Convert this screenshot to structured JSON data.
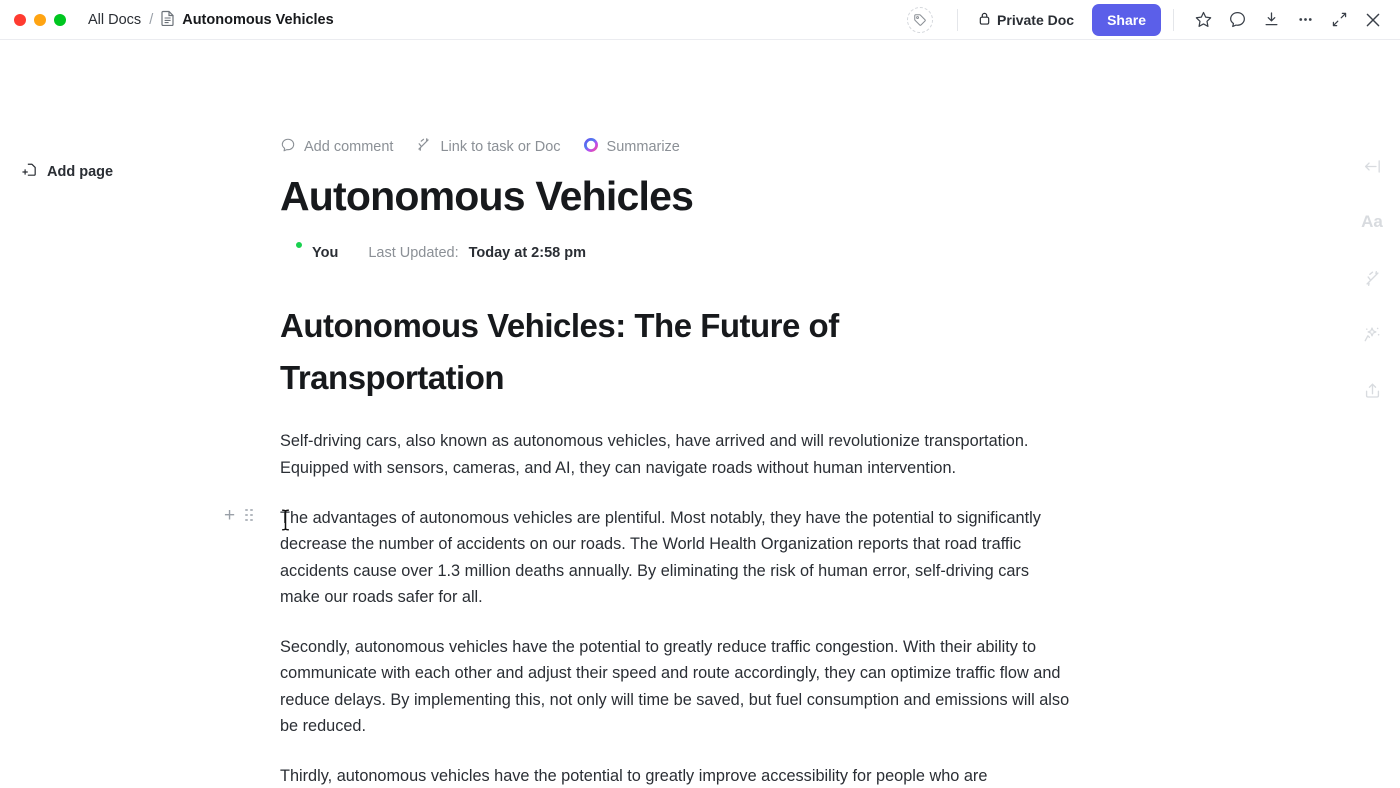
{
  "window": {
    "traffic_lights": [
      "close",
      "minimize",
      "maximize"
    ],
    "colors": {
      "red": "#ff3b30",
      "yellow": "#ffa412",
      "green": "#00c620",
      "accent": "#5b5fe9"
    }
  },
  "breadcrumb": {
    "root": "All Docs",
    "separator": "/",
    "current": "Autonomous Vehicles"
  },
  "titlebar": {
    "tag_icon": "tag-icon",
    "privacy_label": "Private Doc",
    "privacy_icon": "lock-icon",
    "share_label": "Share",
    "icons": [
      {
        "name": "star-icon",
        "title": "Favorite"
      },
      {
        "name": "comment-icon",
        "title": "Comments"
      },
      {
        "name": "download-icon",
        "title": "Download"
      },
      {
        "name": "more-options-icon",
        "title": "More"
      },
      {
        "name": "collapse-icon",
        "title": "Collapse"
      },
      {
        "name": "close-icon",
        "title": "Close"
      }
    ]
  },
  "sidebar": {
    "add_page_label": "Add page",
    "add_page_icon": "add-page-icon"
  },
  "doc_toolbar": {
    "items": [
      {
        "label": "Add comment",
        "icon": "comment-icon"
      },
      {
        "label": "Link to task or Doc",
        "icon": "link-icon"
      },
      {
        "label": "Summarize",
        "icon": "ai-summarize-icon"
      }
    ]
  },
  "document": {
    "title": "Autonomous Vehicles",
    "author": "You",
    "updated_label": "Last Updated:",
    "updated_value": "Today at 2:58 pm",
    "heading": "Autonomous Vehicles: The Future of Transportation",
    "paragraphs": [
      "Self-driving cars, also known as autonomous vehicles, have arrived and will revolutionize transportation. Equipped with sensors, cameras, and AI, they can navigate roads without human intervention.",
      "The advantages of autonomous vehicles are plentiful. Most notably, they have the potential to significantly decrease the number of accidents on our roads. The World Health Organization reports that road traffic accidents cause over 1.3 million deaths annually. By eliminating the risk of human error, self-driving cars make our roads safer for all.",
      "Secondly, autonomous vehicles have the potential to greatly reduce traffic congestion. With their ability to communicate with each other and adjust their speed and route accordingly, they can optimize traffic flow and reduce delays. By implementing this, not only will time be saved, but fuel consumption and emissions will also be reduced.",
      "Thirdly, autonomous vehicles have the potential to greatly improve accessibility for people who are"
    ],
    "block_controls": {
      "add_label": "+",
      "drag_label": "drag-handle"
    }
  },
  "right_rail": {
    "items": [
      {
        "name": "collapse-sidebar-icon",
        "label": ""
      },
      {
        "name": "font-settings-icon",
        "label": "Aa"
      },
      {
        "name": "relationships-icon",
        "label": ""
      },
      {
        "name": "ai-wand-icon",
        "label": ""
      },
      {
        "name": "share-export-icon",
        "label": ""
      }
    ]
  }
}
